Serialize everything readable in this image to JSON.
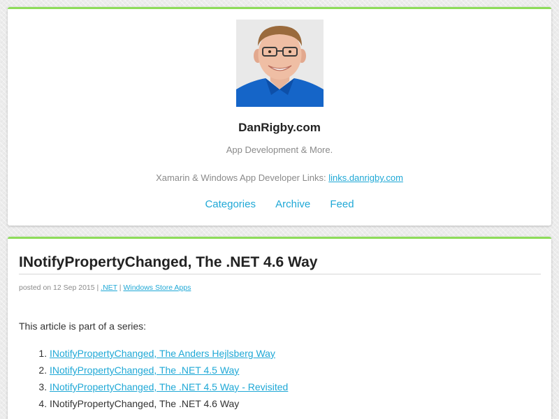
{
  "colors": {
    "accent_border": "#8ddc5a",
    "link": "#1fa8d6",
    "muted_text": "#8a8a8a",
    "title_text": "#222222"
  },
  "header": {
    "avatar": "avatar-photo",
    "site_title": "DanRigby.com",
    "tagline": "App Development & More.",
    "links_text": "Xamarin & Windows App Developer Links: ",
    "links_link": "links.danrigby.com",
    "nav": {
      "categories": "Categories",
      "archive": "Archive",
      "feed": "Feed"
    }
  },
  "post": {
    "title": "INotifyPropertyChanged, The .NET 4.6 Way",
    "meta": {
      "prefix": "posted on 12 Sep 2015 | ",
      "category_1": ".NET",
      "separator": " | ",
      "category_2": "Windows Store Apps"
    },
    "intro": "This article is part of a series:",
    "series": [
      {
        "text": "INotifyPropertyChanged, The Anders Hejlsberg Way",
        "link": true
      },
      {
        "text": "INotifyPropertyChanged, The .NET 4.5 Way",
        "link": true
      },
      {
        "text": "INotifyPropertyChanged, The .NET 4.5 Way - Revisited",
        "link": true
      },
      {
        "text": "INotifyPropertyChanged, The .NET 4.6 Way",
        "link": false
      }
    ]
  }
}
